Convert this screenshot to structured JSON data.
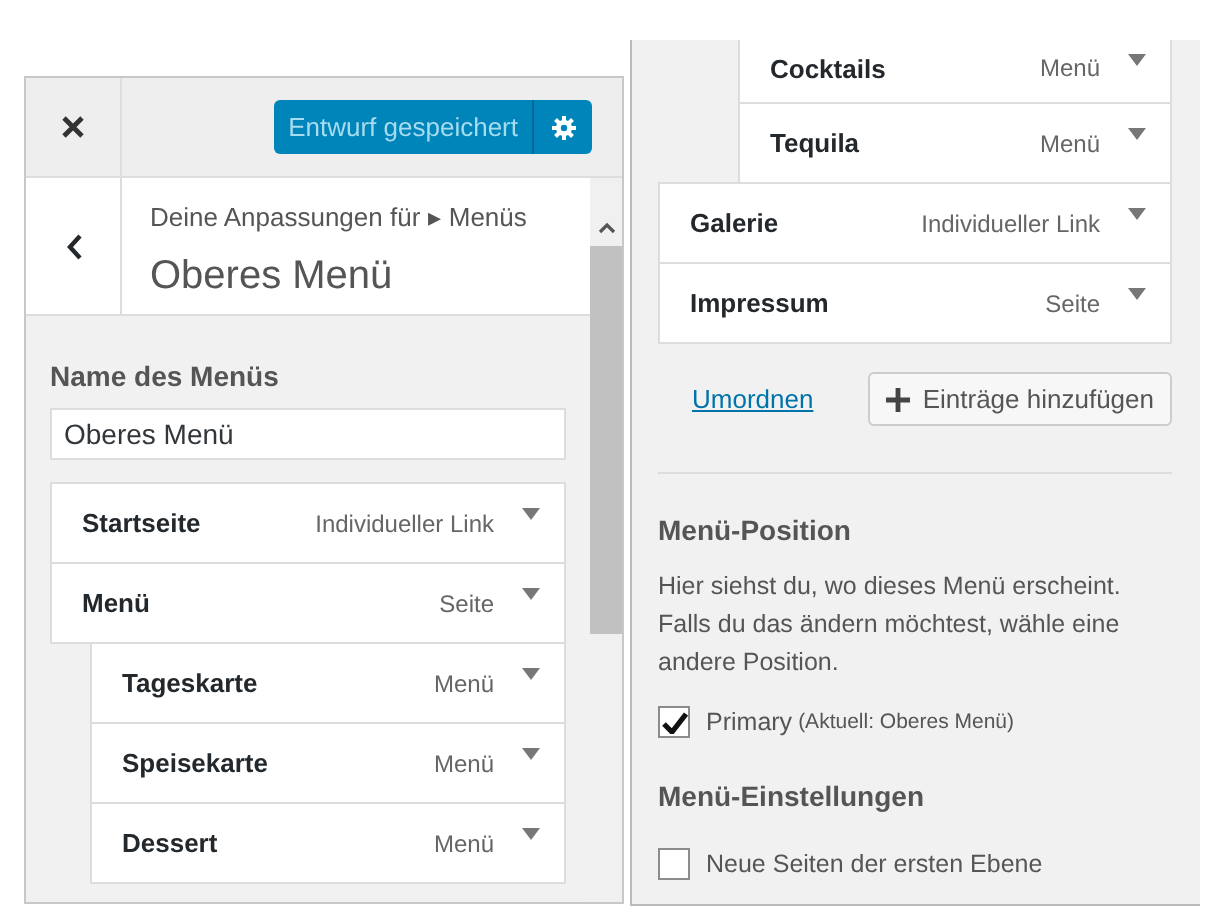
{
  "left_panel": {
    "save_button": {
      "label": "Entwurf gespeichert",
      "disabled": true
    },
    "breadcrumb": "Deine Anpassungen für ▸ Menüs",
    "title": "Oberes Menü",
    "menu_name": {
      "label": "Name des Menüs",
      "value": "Oberes Menü"
    },
    "menu_items": [
      {
        "title": "Startseite",
        "type": "Individueller Link"
      },
      {
        "title": "Menü",
        "type": "Seite",
        "children": [
          {
            "title": "Tageskarte",
            "type": "Menü"
          },
          {
            "title": "Speisekarte",
            "type": "Menü"
          },
          {
            "title": "Dessert",
            "type": "Menü"
          }
        ]
      }
    ]
  },
  "right_panel": {
    "menu_items": [
      {
        "title": "Cocktails",
        "type": "Menü",
        "kind": "nested"
      },
      {
        "title": "Tequila",
        "type": "Menü",
        "kind": "nested"
      },
      {
        "title": "Galerie",
        "type": "Individueller Link",
        "kind": "top"
      },
      {
        "title": "Impressum",
        "type": "Seite",
        "kind": "top"
      }
    ],
    "reorder_link": "Umordnen",
    "add_button": "Einträge hinzufügen",
    "menu_position": {
      "heading": "Menü-Position",
      "description": "Hier siehst du, wo dieses Menü erscheint. Falls du das ändern möchtest, wähle eine andere Position.",
      "locations": [
        {
          "label": "Primary",
          "note": "(Aktuell: Oberes Menü)",
          "checked": true
        }
      ]
    },
    "menu_settings": {
      "heading": "Menü-Einstellungen",
      "options": [
        {
          "label": "Neue Seiten der ersten Ebene",
          "checked": false
        }
      ]
    }
  }
}
